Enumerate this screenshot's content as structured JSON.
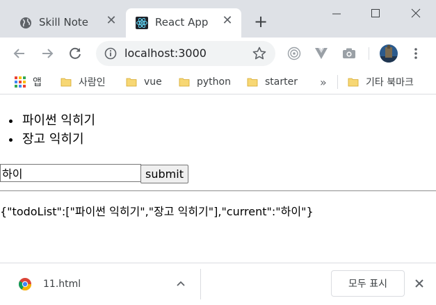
{
  "browser": {
    "tabs": [
      {
        "title": "Skill Note",
        "icon": "globe-icon",
        "active": false
      },
      {
        "title": "React App",
        "icon": "react-logo-icon",
        "active": true
      }
    ],
    "address": "localhost:3000",
    "bookmarks": [
      {
        "label": "앱",
        "icon": "apps-grid-icon"
      },
      {
        "label": "사람인",
        "icon": "folder-icon"
      },
      {
        "label": "vue",
        "icon": "folder-icon"
      },
      {
        "label": "python",
        "icon": "folder-icon"
      },
      {
        "label": "starter",
        "icon": "folder-icon"
      }
    ],
    "bookmarks_overflow": "»",
    "other_bookmarks": "기타 북마크"
  },
  "page": {
    "todo_items": [
      "파이썬 익히기",
      "장고 익히기"
    ],
    "input_value": "하이",
    "submit_label": "submit",
    "state_json": "{\"todoList\":[\"파이썬 익히기\",\"장고 익히기\"],\"current\":\"하이\"}"
  },
  "downloads": {
    "file_name": "11.html",
    "show_all_label": "모두 표시"
  },
  "colors": {
    "titlebar": "#dee1e6",
    "omnibox": "#f1f3f4",
    "folder": "#f7d774"
  }
}
